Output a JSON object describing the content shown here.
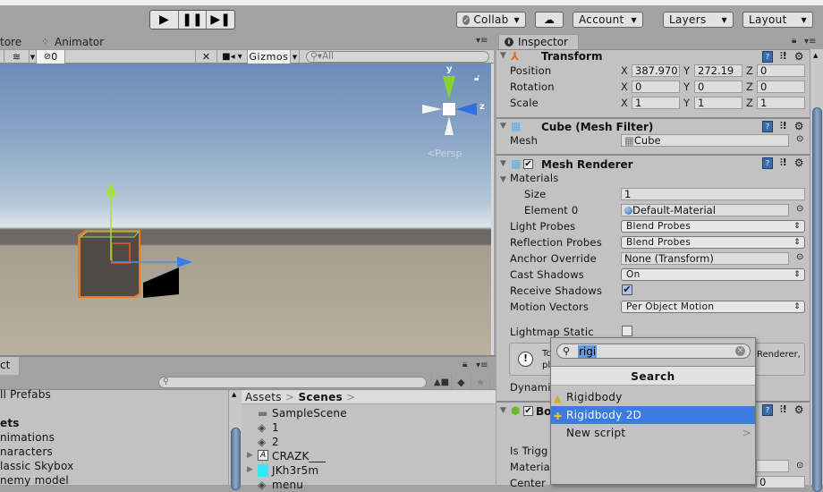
{
  "toolbar": {
    "play_icons": [
      "play-icon",
      "pause-icon",
      "step-icon"
    ],
    "collab_label": "Collab",
    "cloud_icon": "cloud-icon",
    "account_label": "Account",
    "layers_label": "Layers",
    "layout_label": "Layout"
  },
  "scene_tabs": {
    "store_label": "tore",
    "animator_label": "Animator"
  },
  "scene_toolbar": {
    "hidden_count": "0",
    "gizmos_label": "Gizmos",
    "search_placeholder": "All"
  },
  "scene_view": {
    "gizmo_y": "y",
    "gizmo_z": "z",
    "persp_label": "Persp"
  },
  "project": {
    "tab_label": "ct",
    "left_items": [
      {
        "label": "ll Prefabs",
        "bold": false
      },
      {
        "label": "",
        "bold": false
      },
      {
        "label": "ets",
        "bold": true
      },
      {
        "label": "nimations",
        "bold": false
      },
      {
        "label": "naracters",
        "bold": false
      },
      {
        "label": "lassic Skybox",
        "bold": false
      },
      {
        "label": "nemy model",
        "bold": false
      }
    ],
    "breadcrumb": {
      "root": "Assets",
      "current": "Scenes"
    },
    "files": [
      {
        "name": "SampleScene",
        "icon": "folder-icon"
      },
      {
        "name": "1",
        "icon": "unity-scene-icon"
      },
      {
        "name": "2",
        "icon": "unity-scene-icon"
      },
      {
        "name": "CRAZK___",
        "icon": "font-icon"
      },
      {
        "name": "JKh3r5m",
        "icon": "texture-icon"
      },
      {
        "name": "menu",
        "icon": "unity-scene-icon"
      }
    ]
  },
  "inspector": {
    "tab_label": "Inspector",
    "transform": {
      "title": "Transform",
      "rows": [
        {
          "label": "Position",
          "x": "387.9701",
          "y": "272.19",
          "z": "0"
        },
        {
          "label": "Rotation",
          "x": "0",
          "y": "0",
          "z": "0"
        },
        {
          "label": "Scale",
          "x": "1",
          "y": "1",
          "z": "1"
        }
      ]
    },
    "mesh_filter": {
      "title": "Cube (Mesh Filter)",
      "mesh_label": "Mesh",
      "mesh_value": "Cube"
    },
    "mesh_renderer": {
      "title": "Mesh Renderer",
      "enabled": true,
      "materials_label": "Materials",
      "size_label": "Size",
      "size_value": "1",
      "element0_label": "Element 0",
      "element0_value": "Default-Material",
      "light_probes_label": "Light Probes",
      "light_probes_value": "Blend Probes",
      "reflection_probes_label": "Reflection Probes",
      "reflection_probes_value": "Blend Probes",
      "anchor_override_label": "Anchor Override",
      "anchor_override_value": "None (Transform)",
      "cast_shadows_label": "Cast Shadows",
      "cast_shadows_value": "On",
      "receive_shadows_label": "Receive Shadows",
      "receive_shadows": true,
      "motion_vectors_label": "Motion Vectors",
      "motion_vectors_value": "Per Object Motion",
      "lightmap_static_label": "Lightmap Static",
      "lightmap_static": false,
      "info_left_1": "Tc",
      "info_left_2": "pl",
      "info_right": "Renderer,",
      "dynamic_label": "Dynami"
    },
    "box_collider": {
      "title_partial": "Bo",
      "is_trigger_label": "Is Trigg",
      "material_label": "Material",
      "center_label": "Center",
      "center_x": "0"
    }
  },
  "add_component_popup": {
    "search_value": "rigi",
    "header": "Search",
    "items": [
      {
        "label": "Rigidbody",
        "selected": false,
        "has_submenu": false
      },
      {
        "label": "Rigidbody 2D",
        "selected": true,
        "has_submenu": false
      },
      {
        "label": "New script",
        "selected": false,
        "has_submenu": true
      }
    ]
  },
  "colors": {
    "selection": "#3d7be0",
    "inspector_bg": "#c2c2c2",
    "toolbar_bg": "#a2a2a2"
  }
}
